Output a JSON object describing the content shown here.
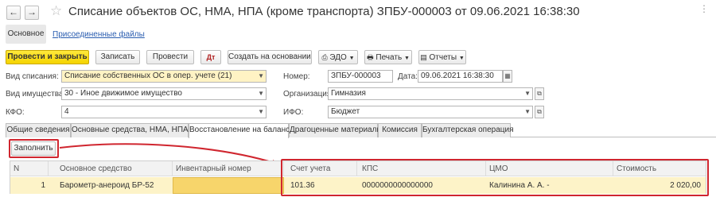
{
  "window": {
    "title": "Списание объектов ОС, НМА, НПА (кроме транспорта) ЗПБУ-000003 от 09.06.2021 16:38:30",
    "back_icon": "←",
    "forward_icon": "→",
    "star_icon": "☆"
  },
  "subtabs": {
    "main": "Основное",
    "attached": "Присоединенные файлы"
  },
  "toolbar": {
    "post_close": "Провести и закрыть",
    "save": "Записать",
    "post": "Провести",
    "create_based": "Создать на основании",
    "edo": "ЭДО",
    "print": "Печать",
    "reports": "Отчеты"
  },
  "form": {
    "writeoff_type_label": "Вид списания:",
    "writeoff_type_value": "Списание собственных ОС в опер. учете (21)",
    "number_label": "Номер:",
    "number_value": "ЗПБУ-000003",
    "date_label": "Дата:",
    "date_value": "09.06.2021 16:38:30",
    "property_type_label": "Вид имущества:",
    "property_type_value": "30 - Иное движимое имущество",
    "org_label": "Организация:",
    "org_value": "Гимназия",
    "kfo_label": "КФО:",
    "kfo_value": "4",
    "ifo_label": "ИФО:",
    "ifo_value": "Бюджет"
  },
  "tabs": [
    "Общие сведения",
    "Основные средства, НМА, НПА",
    "Восстановление на балансе",
    "Драгоценные материалы",
    "Комиссия",
    "Бухгалтерская операция"
  ],
  "fill_button": "Заполнить",
  "table": {
    "headers": [
      "N",
      "Основное средство",
      "Инвентарный номер",
      "Счет учета",
      "КПС",
      "ЦМО",
      "Стоимость"
    ],
    "rows": [
      [
        "1",
        "Барометр-анероид БР-52",
        "",
        "101.36",
        "0000000000000000",
        "Калинина А. А. -",
        "2 020,00"
      ]
    ]
  },
  "colors": {
    "accent_yellow": "#f5d400",
    "highlight_red": "#d0262f",
    "row_yellow": "#fdf3c8"
  }
}
